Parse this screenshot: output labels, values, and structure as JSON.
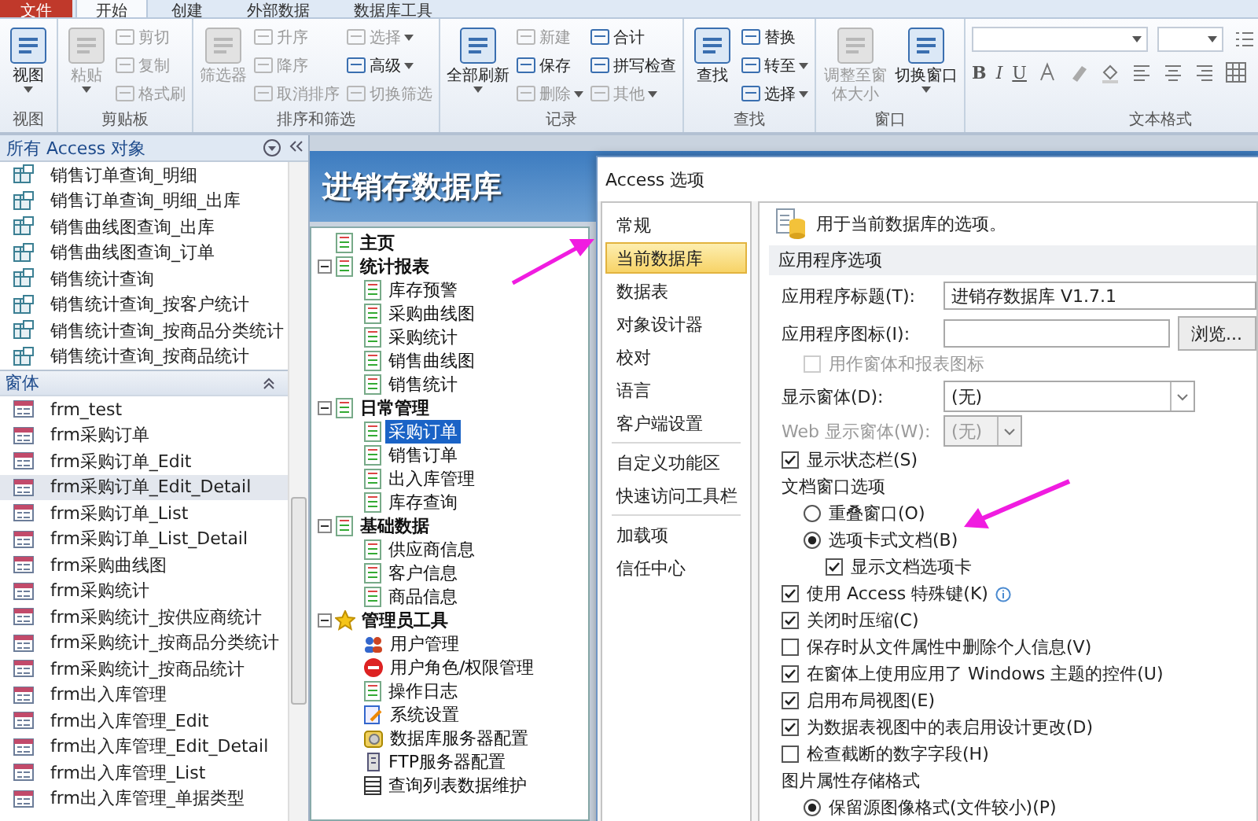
{
  "ribbon": {
    "tabs": [
      {
        "label": "文件",
        "kind": "file",
        "selected": false
      },
      {
        "label": "开始",
        "kind": "tab",
        "selected": true
      },
      {
        "label": "创建",
        "kind": "tab",
        "selected": false
      },
      {
        "label": "外部数据",
        "kind": "tab",
        "selected": false
      },
      {
        "label": "数据库工具",
        "kind": "tab",
        "selected": false
      }
    ],
    "groups": [
      {
        "label": "视图",
        "kind": "buttons",
        "columns": [
          [
            {
              "label": "视图",
              "kind": "large",
              "dropdown": true,
              "disabled": false
            }
          ]
        ]
      },
      {
        "label": "剪贴板",
        "kind": "buttons",
        "columns": [
          [
            {
              "label": "粘贴",
              "kind": "large",
              "dropdown": true,
              "disabled": true
            }
          ],
          [
            {
              "label": "剪切",
              "kind": "small",
              "dropdown": false,
              "disabled": true
            },
            {
              "label": "复制",
              "kind": "small",
              "dropdown": false,
              "disabled": true
            },
            {
              "label": "格式刷",
              "kind": "small",
              "dropdown": false,
              "disabled": true
            }
          ]
        ]
      },
      {
        "label": "排序和筛选",
        "kind": "buttons",
        "columns": [
          [
            {
              "label": "筛选器",
              "kind": "large",
              "dropdown": false,
              "disabled": true
            }
          ],
          [
            {
              "label": "升序",
              "kind": "small",
              "dropdown": false,
              "disabled": true
            },
            {
              "label": "降序",
              "kind": "small",
              "dropdown": false,
              "disabled": true
            },
            {
              "label": "取消排序",
              "kind": "small",
              "dropdown": false,
              "disabled": true
            }
          ],
          [
            {
              "label": "选择",
              "kind": "small",
              "dropdown": true,
              "disabled": true
            },
            {
              "label": "高级",
              "kind": "small",
              "dropdown": true,
              "disabled": false
            },
            {
              "label": "切换筛选",
              "kind": "small",
              "dropdown": false,
              "disabled": true
            }
          ]
        ]
      },
      {
        "label": "记录",
        "kind": "buttons",
        "columns": [
          [
            {
              "label": "全部刷新",
              "kind": "large",
              "dropdown": true,
              "disabled": false
            }
          ],
          [
            {
              "label": "新建",
              "kind": "small",
              "dropdown": false,
              "disabled": true
            },
            {
              "label": "保存",
              "kind": "small",
              "dropdown": false,
              "disabled": false
            },
            {
              "label": "删除",
              "kind": "small",
              "dropdown": true,
              "disabled": true
            }
          ],
          [
            {
              "label": "合计",
              "kind": "small",
              "dropdown": false,
              "disabled": false
            },
            {
              "label": "拼写检查",
              "kind": "small",
              "dropdown": false,
              "disabled": false
            },
            {
              "label": "其他",
              "kind": "small",
              "dropdown": true,
              "disabled": true
            }
          ]
        ]
      },
      {
        "label": "查找",
        "kind": "buttons",
        "columns": [
          [
            {
              "label": "查找",
              "kind": "large",
              "dropdown": false,
              "disabled": false
            }
          ],
          [
            {
              "label": "替换",
              "kind": "small",
              "dropdown": false,
              "disabled": false
            },
            {
              "label": "转至",
              "kind": "small",
              "dropdown": true,
              "disabled": false
            },
            {
              "label": "选择",
              "kind": "small",
              "dropdown": true,
              "disabled": false
            }
          ]
        ]
      },
      {
        "label": "窗口",
        "kind": "buttons",
        "columns": [
          [
            {
              "label": "调整至窗体大小",
              "kind": "large",
              "dropdown": false,
              "disabled": true
            }
          ],
          [
            {
              "label": "切换窗口",
              "kind": "large",
              "dropdown": true,
              "disabled": false
            }
          ]
        ]
      },
      {
        "label": "文本格式",
        "kind": "format",
        "letters": [
          "B",
          "I",
          "U"
        ]
      }
    ]
  },
  "navigation": {
    "title": "所有 Access 对象",
    "sections": [
      {
        "kind": "query",
        "items": [
          {
            "label": "销售订单查询_明细",
            "selected": false
          },
          {
            "label": "销售订单查询_明细_出库",
            "selected": false
          },
          {
            "label": "销售曲线图查询_出库",
            "selected": false
          },
          {
            "label": "销售曲线图查询_订单",
            "selected": false
          },
          {
            "label": "销售统计查询",
            "selected": false
          },
          {
            "label": "销售统计查询_按客户统计",
            "selected": false
          },
          {
            "label": "销售统计查询_按商品分类统计",
            "selected": false
          },
          {
            "label": "销售统计查询_按商品统计",
            "selected": false
          }
        ]
      },
      {
        "label": "窗体",
        "kind": "form",
        "expanded": true,
        "items": [
          {
            "label": "frm_test",
            "selected": false
          },
          {
            "label": "frm采购订单",
            "selected": false
          },
          {
            "label": "frm采购订单_Edit",
            "selected": false
          },
          {
            "label": "frm采购订单_Edit_Detail",
            "selected": true
          },
          {
            "label": "frm采购订单_List",
            "selected": false
          },
          {
            "label": "frm采购订单_List_Detail",
            "selected": false
          },
          {
            "label": "frm采购曲线图",
            "selected": false
          },
          {
            "label": "frm采购统计",
            "selected": false
          },
          {
            "label": "frm采购统计_按供应商统计",
            "selected": false
          },
          {
            "label": "frm采购统计_按商品分类统计",
            "selected": false
          },
          {
            "label": "frm采购统计_按商品统计",
            "selected": false
          },
          {
            "label": "frm出入库管理",
            "selected": false
          },
          {
            "label": "frm出入库管理_Edit",
            "selected": false
          },
          {
            "label": "frm出入库管理_Edit_Detail",
            "selected": false
          },
          {
            "label": "frm出入库管理_List",
            "selected": false
          },
          {
            "label": "frm出入库管理_单据类型",
            "selected": false
          }
        ]
      }
    ]
  },
  "app": {
    "title": "进销存数据库",
    "tree": [
      {
        "label": "主页",
        "kind": "report",
        "selected": false
      },
      {
        "label": "统计报表",
        "kind": "report",
        "selected": false,
        "expanded": true,
        "children": [
          {
            "label": "库存预警",
            "kind": "report",
            "selected": false
          },
          {
            "label": "采购曲线图",
            "kind": "report",
            "selected": false
          },
          {
            "label": "采购统计",
            "kind": "report",
            "selected": false
          },
          {
            "label": "销售曲线图",
            "kind": "report",
            "selected": false
          },
          {
            "label": "销售统计",
            "kind": "report",
            "selected": false
          }
        ]
      },
      {
        "label": "日常管理",
        "kind": "report",
        "selected": false,
        "expanded": true,
        "children": [
          {
            "label": "采购订单",
            "kind": "report",
            "selected": true
          },
          {
            "label": "销售订单",
            "kind": "report",
            "selected": false
          },
          {
            "label": "出入库管理",
            "kind": "report",
            "selected": false
          },
          {
            "label": "库存查询",
            "kind": "report",
            "selected": false
          }
        ]
      },
      {
        "label": "基础数据",
        "kind": "report",
        "selected": false,
        "expanded": true,
        "children": [
          {
            "label": "供应商信息",
            "kind": "report",
            "selected": false
          },
          {
            "label": "客户信息",
            "kind": "report",
            "selected": false
          },
          {
            "label": "商品信息",
            "kind": "report",
            "selected": false
          }
        ]
      },
      {
        "label": "管理员工具",
        "kind": "star",
        "selected": false,
        "expanded": true,
        "children": [
          {
            "label": "用户管理",
            "kind": "users",
            "selected": false
          },
          {
            "label": "用户角色/权限管理",
            "kind": "stop",
            "selected": false
          },
          {
            "label": "操作日志",
            "kind": "report",
            "selected": false
          },
          {
            "label": "系统设置",
            "kind": "settings",
            "selected": false
          },
          {
            "label": "数据库服务器配置",
            "kind": "database",
            "selected": false
          },
          {
            "label": "FTP服务器配置",
            "kind": "server",
            "selected": false
          },
          {
            "label": "查询列表数据维护",
            "kind": "grid",
            "selected": false
          }
        ]
      }
    ]
  },
  "dialog": {
    "title": "Access 选项",
    "category_groups": [
      {
        "items": [
          {
            "label": "常规",
            "selected": false
          },
          {
            "label": "当前数据库",
            "selected": true
          },
          {
            "label": "数据表",
            "selected": false
          },
          {
            "label": "对象设计器",
            "selected": false
          },
          {
            "label": "校对",
            "selected": false
          },
          {
            "label": "语言",
            "selected": false
          },
          {
            "label": "客户端设置",
            "selected": false
          }
        ]
      },
      {
        "items": [
          {
            "label": "自定义功能区",
            "selected": false
          },
          {
            "label": "快速访问工具栏",
            "selected": false
          }
        ]
      },
      {
        "items": [
          {
            "label": "加载项",
            "selected": false
          },
          {
            "label": "信任中心",
            "selected": false
          }
        ]
      }
    ],
    "description": "用于当前数据库的选项。",
    "section": "应用程序选项",
    "rows": [
      {
        "kind": "text_field",
        "label": "应用程序标题(T):",
        "value": "进销存数据库 V1.7.1"
      },
      {
        "kind": "text_field",
        "label": "应用程序图标(I):",
        "button": "浏览...",
        "children": [
          {
            "kind": "checkbox",
            "label": "用作窗体和报表图标",
            "checked": false,
            "disabled": true
          }
        ]
      },
      {
        "kind": "select",
        "label": "显示窗体(D):",
        "value": "(无)",
        "disabled": false
      },
      {
        "kind": "select",
        "label": "Web 显示窗体(W):",
        "value": "(无)",
        "disabled": true
      },
      {
        "kind": "checkbox",
        "label": "显示状态栏(S)",
        "checked": true,
        "disabled": false
      },
      {
        "kind": "label",
        "label": "文档窗口选项",
        "children": [
          {
            "kind": "radio",
            "label": "重叠窗口(O)",
            "selected": false
          },
          {
            "kind": "radio",
            "label": "选项卡式文档(B)",
            "selected": true,
            "children": [
              {
                "kind": "checkbox",
                "label": "显示文档选项卡",
                "checked": true,
                "disabled": false
              }
            ]
          }
        ]
      },
      {
        "kind": "checkbox",
        "label": "使用 Access 特殊键(K)",
        "checked": true,
        "disabled": false,
        "info": true
      },
      {
        "kind": "checkbox",
        "label": "关闭时压缩(C)",
        "checked": true,
        "disabled": false
      },
      {
        "kind": "checkbox",
        "label": "保存时从文件属性中删除个人信息(V)",
        "checked": false,
        "disabled": false
      },
      {
        "kind": "checkbox",
        "label": "在窗体上使用应用了 Windows 主题的控件(U)",
        "checked": true,
        "disabled": false
      },
      {
        "kind": "checkbox",
        "label": "启用布局视图(E)",
        "checked": true,
        "disabled": false
      },
      {
        "kind": "checkbox",
        "label": "为数据表视图中的表启用设计更改(D)",
        "checked": true,
        "disabled": false
      },
      {
        "kind": "checkbox",
        "label": "检查截断的数字字段(H)",
        "checked": false,
        "disabled": false
      },
      {
        "kind": "label",
        "label": "图片属性存储格式",
        "children": [
          {
            "kind": "radio",
            "label": "保留源图像格式(文件较小)(P)",
            "selected": true
          }
        ]
      }
    ]
  }
}
